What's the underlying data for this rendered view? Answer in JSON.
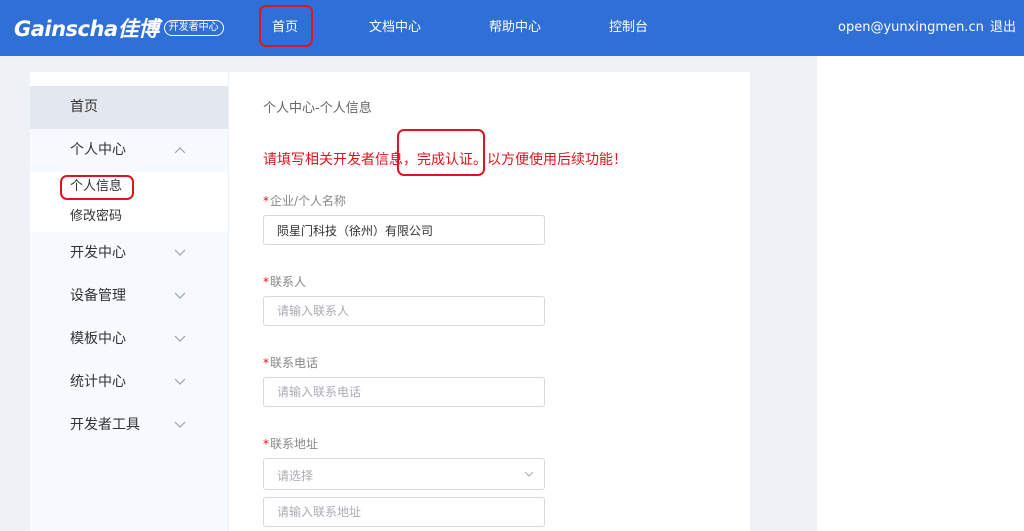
{
  "header": {
    "brand": "Gainscha佳博",
    "brand_badge": "开发者中心",
    "nav": {
      "home": "首页",
      "docs": "文档中心",
      "help": "帮助中心",
      "console": "控制台"
    },
    "user_email": "open@yunxingmen.cn",
    "logout": "退出"
  },
  "sidebar": {
    "home": "首页",
    "personal_center": "个人中心",
    "personal_info": "个人信息",
    "change_password": "修改密码",
    "dev_center": "开发中心",
    "device_mgmt": "设备管理",
    "template_center": "模板中心",
    "stats_center": "统计中心",
    "dev_tools": "开发者工具"
  },
  "main": {
    "breadcrumb": "个人中心-个人信息",
    "notice": "请填写相关开发者信息，完成认证。以方便使用后续功能！",
    "required_mark": "*",
    "fields": {
      "company": {
        "label": "企业/个人名称",
        "value": "陨星门科技（徐州）有限公司"
      },
      "contact": {
        "label": "联系人",
        "placeholder": "请输入联系人"
      },
      "phone": {
        "label": "联系电话",
        "placeholder": "请输入联系电话"
      },
      "address": {
        "label": "联系地址",
        "select_placeholder": "请选择",
        "placeholder": "请输入联系地址"
      }
    }
  },
  "colors": {
    "header_bg": "#2f6fd8",
    "highlight": "#e0141e",
    "notice": "#e0141e"
  }
}
